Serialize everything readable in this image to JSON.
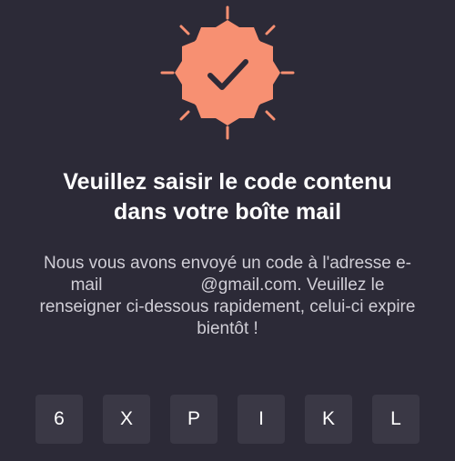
{
  "badge": {
    "icon": "verified-check-icon",
    "color": "#f79072"
  },
  "heading": {
    "line1": "Veuillez saisir le code contenu",
    "line2": "dans votre boîte mail"
  },
  "description": {
    "line1": "Nous vous avons envoyé un code à l'adresse e-",
    "line2_prefix": "mail",
    "line2_suffix": "@gmail.com. Veuillez le",
    "line3": "renseigner ci-dessous rapidement, celui-ci expire",
    "line4": "bientôt !"
  },
  "code": {
    "characters": [
      "6",
      "X",
      "P",
      "I",
      "K",
      "L"
    ]
  }
}
